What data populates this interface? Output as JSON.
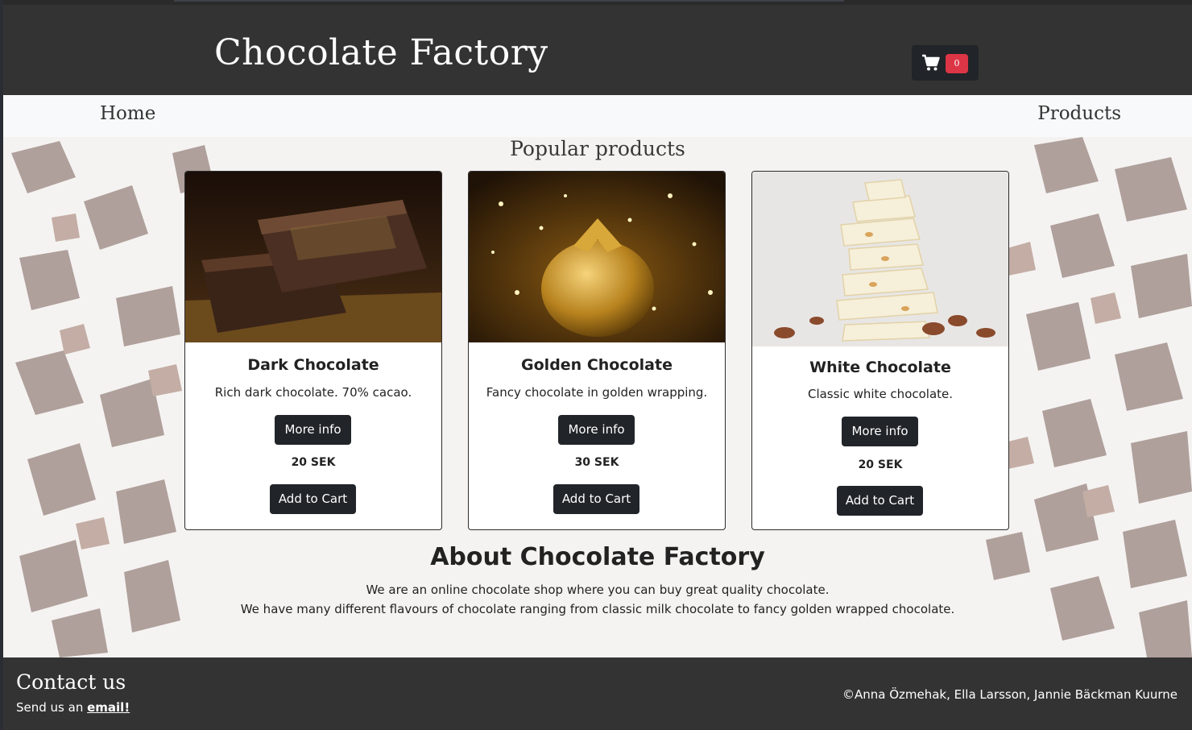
{
  "header": {
    "brand": "Chocolate Factory",
    "cart": {
      "icon": "shopping-cart-icon",
      "count": "0"
    }
  },
  "nav": {
    "home": "Home",
    "products": "Products"
  },
  "popular": {
    "title": "Popular products",
    "products": [
      {
        "name": "Dark Chocolate",
        "description": "Rich dark chocolate. 70% cacao.",
        "more_label": "More info",
        "price": "20 SEK",
        "add_label": "Add to Cart"
      },
      {
        "name": "Golden Chocolate",
        "description": "Fancy chocolate in golden wrapping.",
        "more_label": "More info",
        "price": "30 SEK",
        "add_label": "Add to Cart"
      },
      {
        "name": "White Chocolate",
        "description": "Classic white chocolate.",
        "more_label": "More info",
        "price": "20 SEK",
        "add_label": "Add to Cart"
      }
    ]
  },
  "about": {
    "title": "About Chocolate Factory",
    "line1": "We are an online chocolate shop where you can buy great quality chocolate.",
    "line2": "We have many different flavours of chocolate ranging from classic milk chocolate to fancy golden wrapped chocolate."
  },
  "footer": {
    "contact_title": "Contact us",
    "contact_prefix": "Send us an ",
    "contact_link": "email!",
    "copyright": "©Anna Özmehak, Ella Larsson, Jannie Bäckman Kuurne"
  },
  "colors": {
    "header_bg": "#333333",
    "nav_bg": "#f8f9fa",
    "button_bg": "#212529",
    "badge_bg": "#dc3545"
  }
}
